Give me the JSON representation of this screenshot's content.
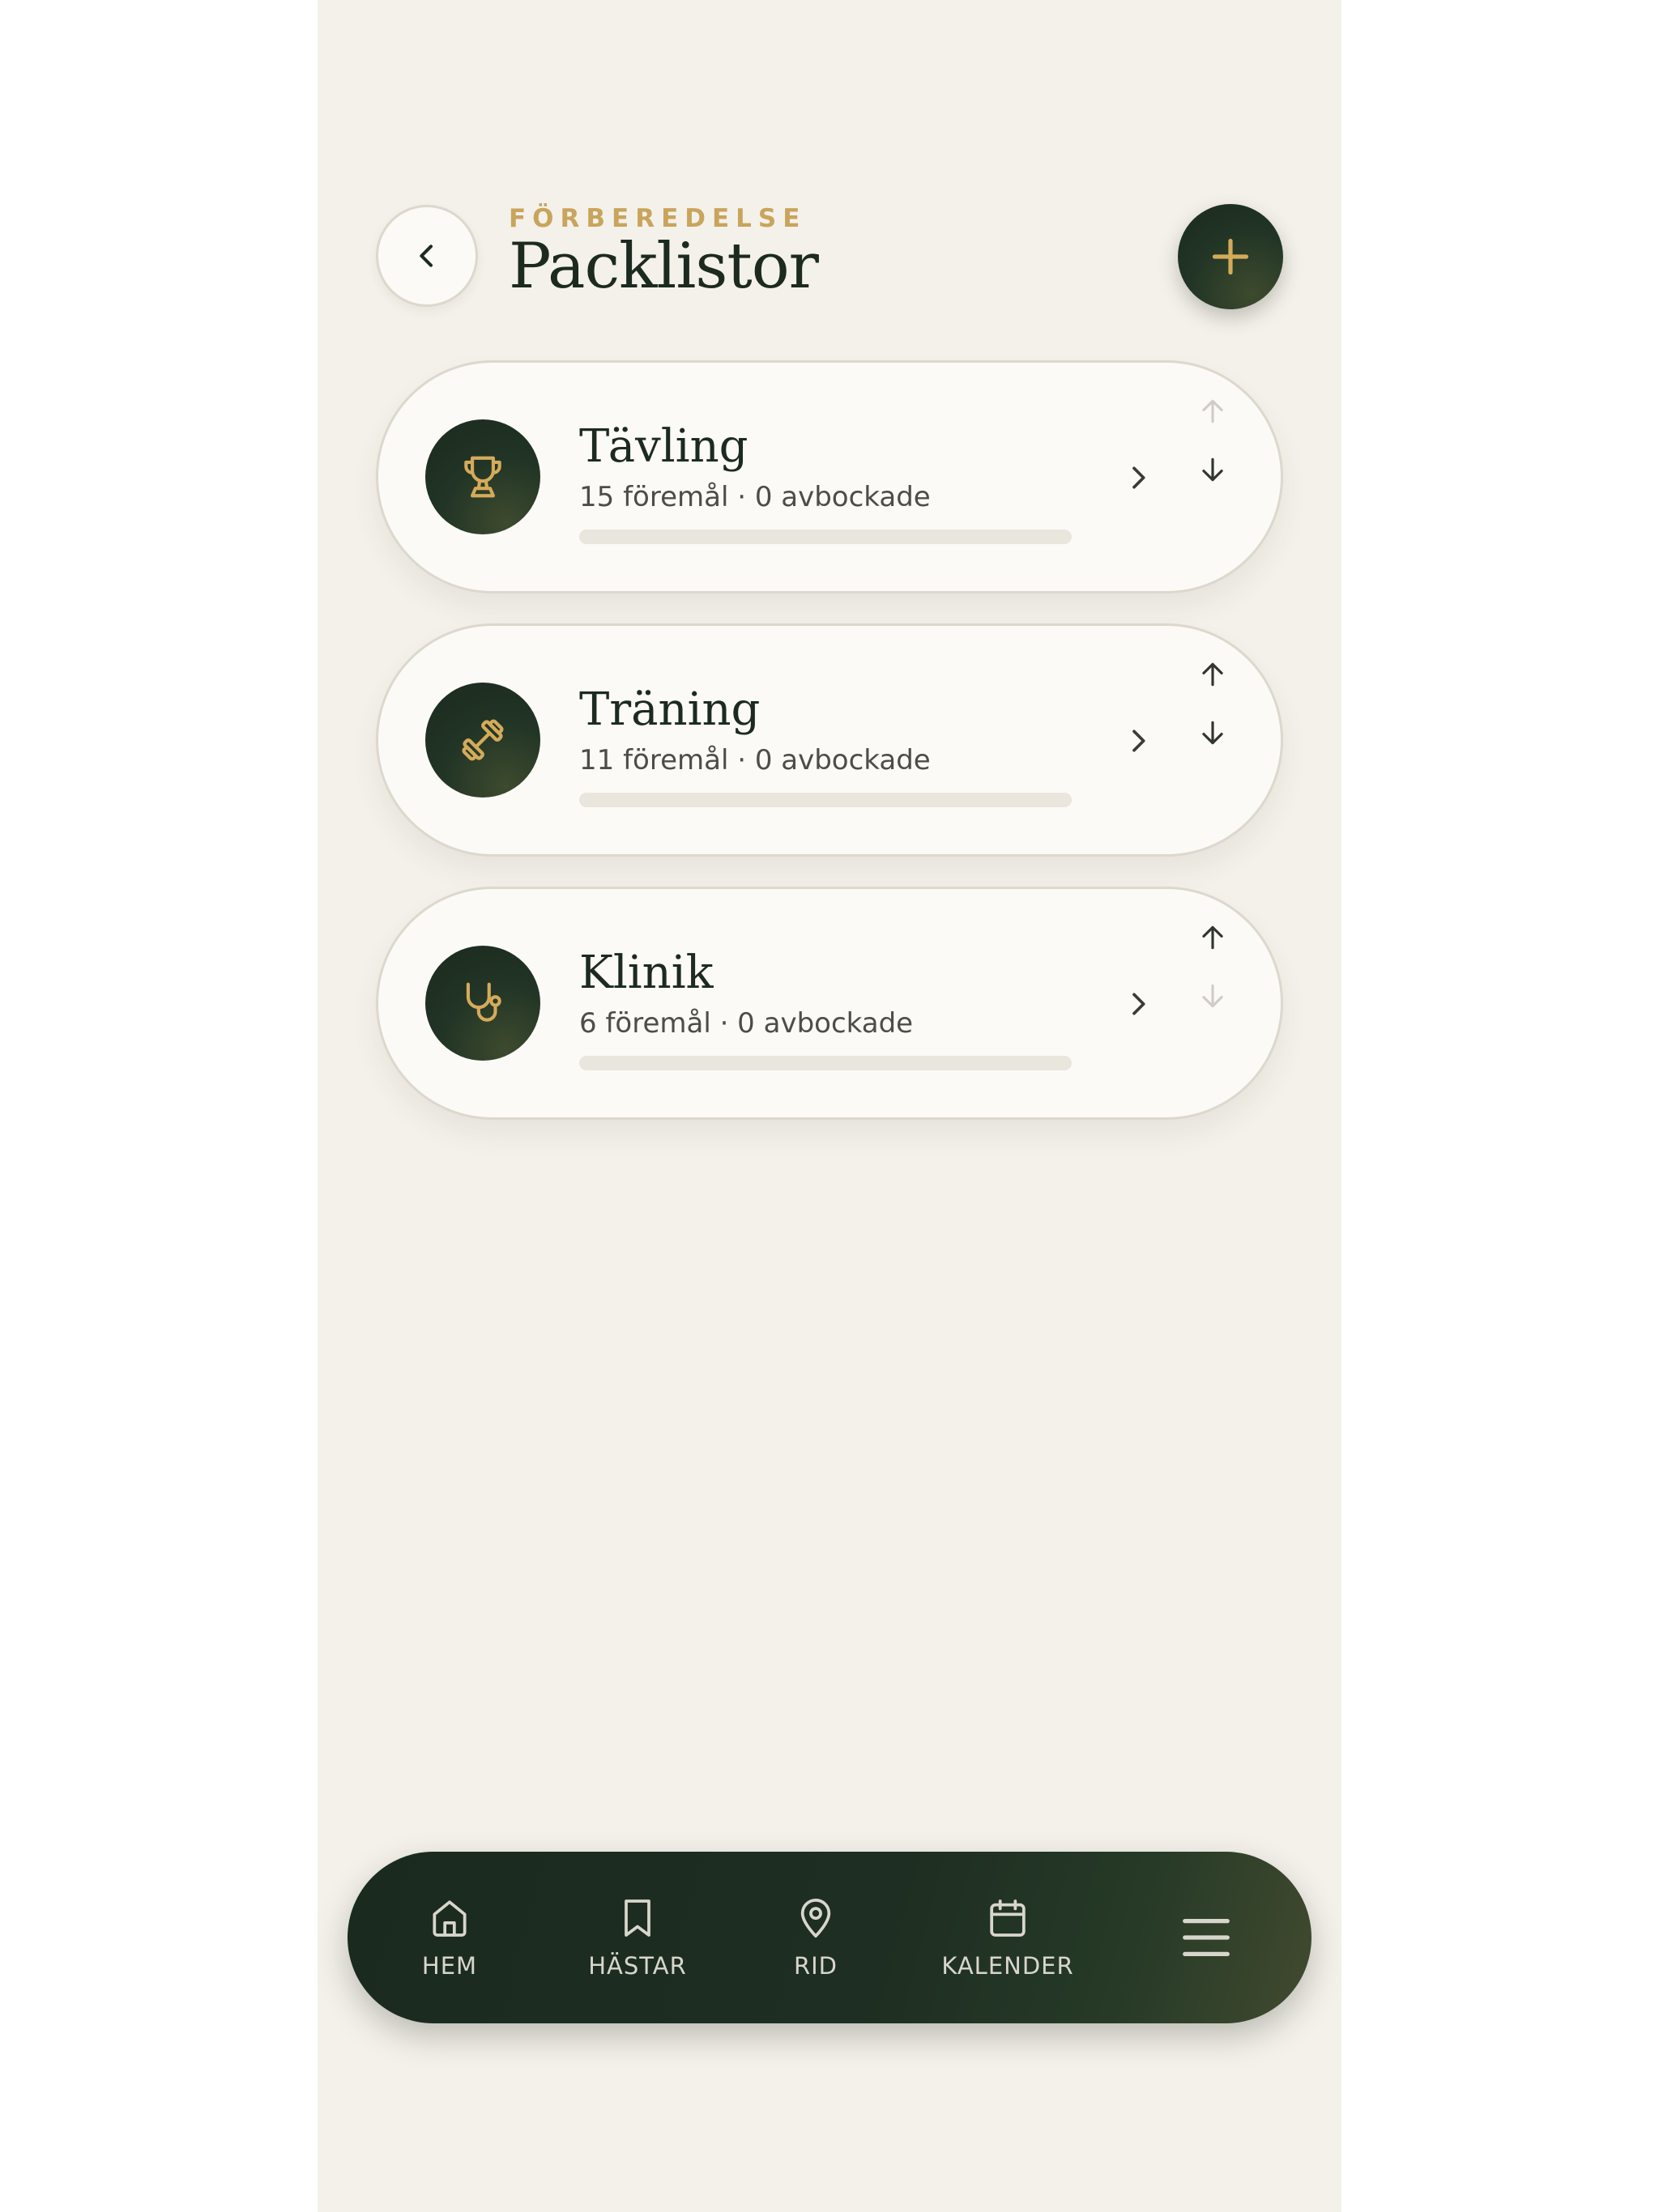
{
  "header": {
    "eyebrow": "FÖRBEREDELSE",
    "title": "Packlistor"
  },
  "lists": [
    {
      "title": "Tävling",
      "subtitle": "15 föremål · 0 avbockade",
      "icon": "trophy-icon",
      "progress": 0,
      "can_move_up": false,
      "can_move_down": true
    },
    {
      "title": "Träning",
      "subtitle": "11 föremål · 0 avbockade",
      "icon": "dumbbell-icon",
      "progress": 0,
      "can_move_up": true,
      "can_move_down": true
    },
    {
      "title": "Klinik",
      "subtitle": "6 föremål · 0 avbockade",
      "icon": "stethoscope-icon",
      "progress": 0,
      "can_move_up": true,
      "can_move_down": false
    }
  ],
  "nav": {
    "items": [
      {
        "label": "HEM",
        "icon": "home-icon"
      },
      {
        "label": "HÄSTAR",
        "icon": "bookmark-icon"
      },
      {
        "label": "RID",
        "icon": "map-pin-icon"
      },
      {
        "label": "KALENDER",
        "icon": "calendar-icon"
      },
      {
        "label": "",
        "icon": "menu-icon"
      }
    ]
  },
  "colors": {
    "background": "#f4f1ea",
    "card": "#fbfaf6",
    "dark_green": "#1b2a1f",
    "gold": "#c9a45c"
  }
}
